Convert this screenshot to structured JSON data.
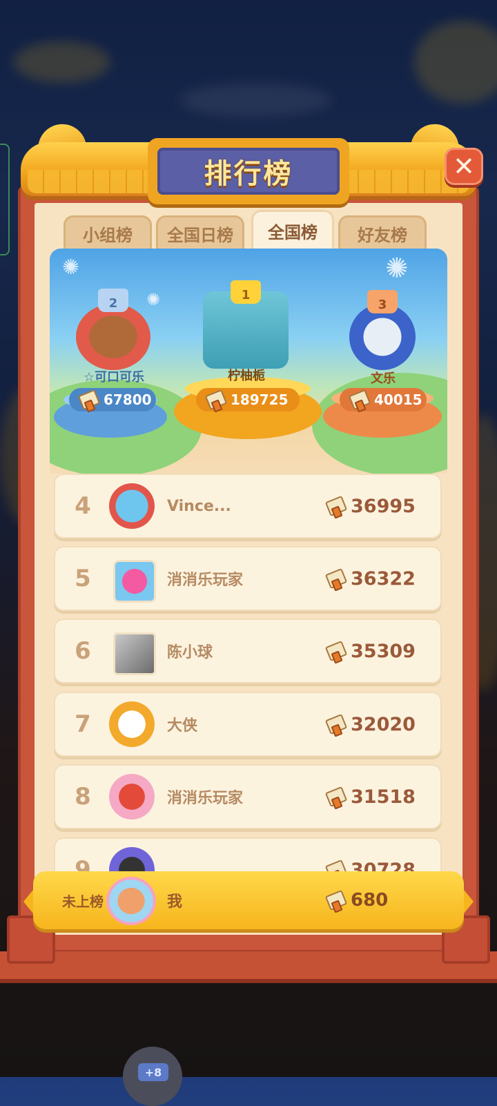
{
  "title": "排行榜",
  "close_label": "✕",
  "tabs": [
    {
      "label": "小组榜",
      "active": false
    },
    {
      "label": "全国日榜",
      "active": false
    },
    {
      "label": "全国榜",
      "active": true
    },
    {
      "label": "好友榜",
      "active": false
    }
  ],
  "podium": [
    {
      "rank": "2",
      "name": "☆可口可乐",
      "score": "67800",
      "color": "#6aaee8"
    },
    {
      "rank": "1",
      "name": "柠柚栀",
      "score": "189725",
      "color": "#f7b21f"
    },
    {
      "rank": "3",
      "name": "文乐",
      "score": "40015",
      "color": "#f08c45"
    }
  ],
  "list": [
    {
      "rank": "4",
      "name": "Vince...",
      "score": "36995",
      "avatar": "blue-creature-flower-frame-icon"
    },
    {
      "rank": "5",
      "name": "消消乐玩家",
      "score": "36322",
      "avatar": "pink-octopus-icon"
    },
    {
      "rank": "6",
      "name": "陈小球",
      "score": "35309",
      "avatar": "grey-photo-avatar"
    },
    {
      "rank": "7",
      "name": "大侠",
      "score": "32020",
      "avatar": "crown-frame-photo-avatar"
    },
    {
      "rank": "8",
      "name": "消消乐玩家",
      "score": "31518",
      "avatar": "heart-frame-red-creature-icon"
    },
    {
      "rank": "9",
      "name": "",
      "score": "30728",
      "avatar": "rap-cap-avatar"
    }
  ],
  "me": {
    "status": "未上榜",
    "name": "我",
    "score": "680",
    "avatar": "heart-frame-cats-icon"
  },
  "bottom_badge": "+8"
}
